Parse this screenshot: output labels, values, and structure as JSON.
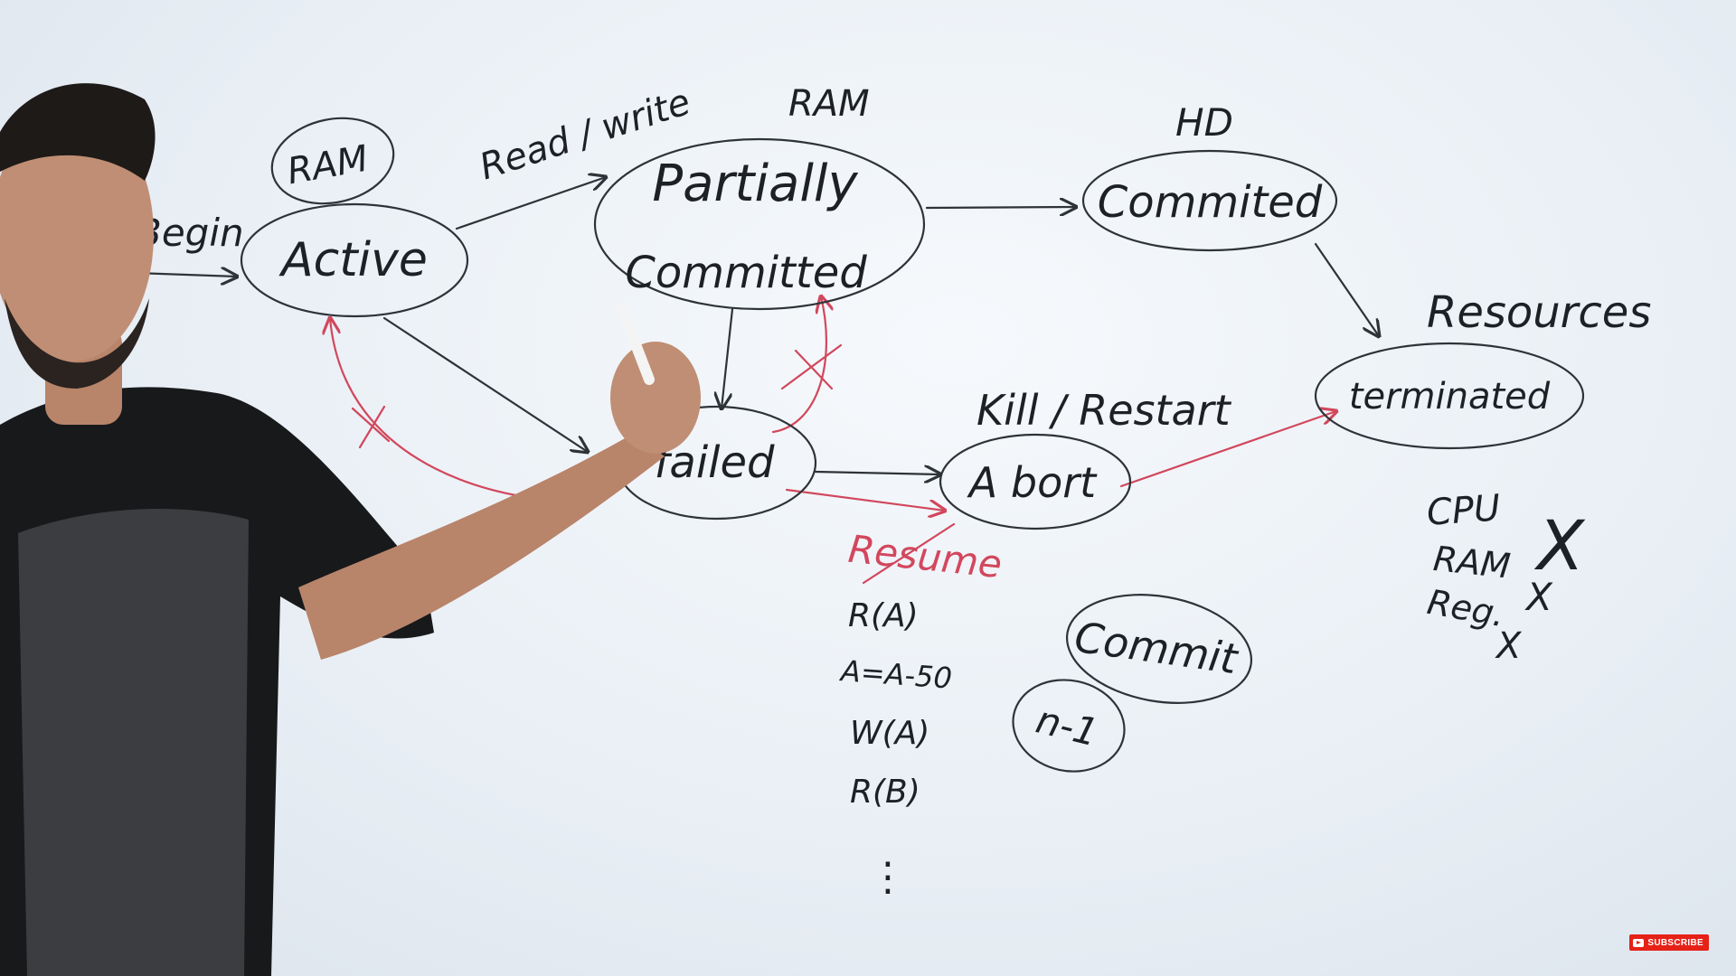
{
  "colors": {
    "ink": "#1d2126",
    "red_marker": "#d2475d",
    "board": "#eef3f7"
  },
  "diagram": {
    "annotations": {
      "begin": "Begin",
      "read_write": "Read / write",
      "ram_active": "RAM",
      "ram_partial": "RAM",
      "hd": "HD",
      "kill_restart": "Kill / Restart",
      "resources": "Resources",
      "resume": "Resume"
    },
    "states": {
      "active": "Active",
      "partially_committed_line1": "Partially",
      "partially_committed_line2": "Committed",
      "committed": "Commited",
      "failed": "failed",
      "abort": "A bort",
      "terminated": "terminated",
      "commit": "Commit",
      "n_minus_1": "n-1"
    },
    "operations": [
      "R(A)",
      "A=A-50",
      "W(A)",
      "R(B)",
      "⋮"
    ],
    "released_resources": [
      "CPU",
      "RAM",
      "Reg."
    ],
    "cross_mark": "X"
  },
  "overlay": {
    "subscribe_label": "SUBSCRIBE",
    "subscribe_icon": "play-icon"
  }
}
